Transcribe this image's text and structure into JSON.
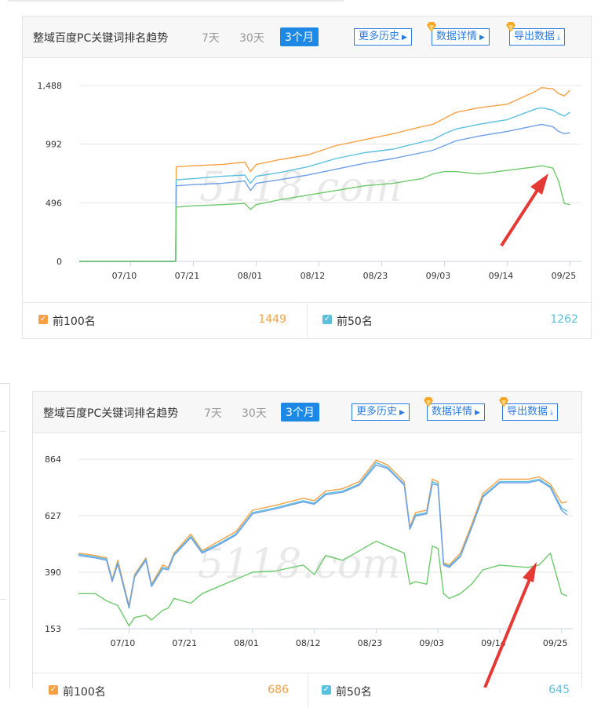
{
  "colors": {
    "top100": "#f5a043",
    "top50": "#5bc0de",
    "top20": "#6f9fe6",
    "top10": "#6cc96c",
    "accent": "#1e88e5",
    "arrow": "#e53935"
  },
  "icons": [
    "vip-diamond-icon",
    "caret-right-icon",
    "download-icon",
    "checkbox-checked-icon",
    "red-arrow-annotation"
  ],
  "panels": [
    {
      "title": "整域百度PC关键词排名趋势",
      "tabs": [
        {
          "label": "7天",
          "active": false
        },
        {
          "label": "30天",
          "active": false
        },
        {
          "label": "3个月",
          "active": true
        }
      ],
      "buttons": {
        "history": "更多历史",
        "details": "数据详情",
        "export": "导出数据"
      },
      "watermark": "5118.com",
      "footer": [
        {
          "label": "前100名",
          "value": "1449"
        },
        {
          "label": "前50名",
          "value": "1262"
        }
      ]
    },
    {
      "title": "整域百度PC关键词排名趋势",
      "tabs": [
        {
          "label": "7天",
          "active": false
        },
        {
          "label": "30天",
          "active": false
        },
        {
          "label": "3个月",
          "active": true
        }
      ],
      "buttons": {
        "history": "更多历史",
        "details": "数据详情",
        "export": "导出数据"
      },
      "watermark": "5118.com",
      "footer": [
        {
          "label": "前100名",
          "value": "686"
        },
        {
          "label": "前50名",
          "value": "645"
        }
      ]
    }
  ],
  "chart_data": [
    {
      "type": "line",
      "ytick_labels": [
        "0",
        "496",
        "992",
        "1,488"
      ],
      "yticks": [
        0,
        496,
        992,
        1488
      ],
      "ylim": [
        0,
        1488
      ],
      "xtick_labels": [
        "07/10",
        "07/21",
        "08/01",
        "08/12",
        "08/23",
        "09/03",
        "09/14",
        "09/25"
      ],
      "xticks": [
        9,
        20,
        31,
        42,
        53,
        64,
        75,
        86
      ],
      "xlim": [
        0,
        88
      ],
      "grid": "horizontal",
      "x": [
        0,
        10,
        16.9,
        17,
        20,
        25,
        29,
        30,
        31,
        35,
        40,
        45,
        50,
        55,
        60,
        62,
        64,
        66,
        70,
        75,
        80,
        81,
        83,
        84,
        85,
        86
      ],
      "series": [
        {
          "values": [
            0,
            0,
            0,
            800,
            810,
            820,
            840,
            760,
            820,
            860,
            900,
            980,
            1030,
            1080,
            1140,
            1160,
            1210,
            1260,
            1300,
            1330,
            1440,
            1470,
            1460,
            1420,
            1400,
            1449
          ]
        },
        {
          "values": [
            0,
            0,
            0,
            690,
            700,
            720,
            730,
            660,
            720,
            750,
            800,
            870,
            920,
            950,
            1010,
            1030,
            1080,
            1120,
            1160,
            1200,
            1290,
            1300,
            1280,
            1250,
            1230,
            1262
          ]
        },
        {
          "values": [
            0,
            0,
            0,
            640,
            650,
            660,
            680,
            600,
            660,
            690,
            730,
            780,
            830,
            870,
            920,
            940,
            980,
            1020,
            1060,
            1100,
            1150,
            1160,
            1140,
            1100,
            1080,
            1090
          ]
        },
        {
          "values": [
            0,
            0,
            0,
            460,
            470,
            480,
            490,
            440,
            480,
            520,
            560,
            600,
            640,
            660,
            700,
            740,
            760,
            760,
            740,
            770,
            800,
            810,
            790,
            680,
            490,
            480
          ]
        }
      ]
    },
    {
      "type": "line",
      "ytick_labels": [
        "153",
        "390",
        "627",
        "864"
      ],
      "yticks": [
        153,
        390,
        627,
        864
      ],
      "ylim": [
        153,
        864
      ],
      "xtick_labels": [
        "07/10",
        "07/21",
        "08/01",
        "08/12",
        "08/23",
        "09/03",
        "09/14",
        "09/25"
      ],
      "xticks": [
        9,
        20,
        31,
        42,
        53,
        64,
        75,
        86
      ],
      "xlim": [
        0,
        88
      ],
      "grid": "horizontal",
      "x": [
        0,
        3,
        5,
        6,
        7,
        9,
        10,
        12,
        13,
        15,
        16,
        17,
        20,
        22,
        25,
        28,
        31,
        35,
        40,
        42,
        44,
        47,
        50,
        53,
        55,
        58,
        59,
        60,
        62,
        63,
        64,
        65,
        66,
        68,
        70,
        72,
        75,
        80,
        82,
        84,
        86,
        87
      ],
      "series": [
        {
          "values": [
            470,
            460,
            450,
            360,
            440,
            250,
            380,
            450,
            340,
            420,
            410,
            470,
            550,
            480,
            520,
            560,
            650,
            670,
            700,
            690,
            730,
            740,
            770,
            860,
            840,
            770,
            580,
            640,
            650,
            780,
            770,
            430,
            420,
            470,
            590,
            720,
            780,
            780,
            790,
            760,
            680,
            686
          ]
        },
        {
          "values": [
            465,
            455,
            445,
            355,
            430,
            245,
            375,
            445,
            335,
            410,
            405,
            465,
            540,
            475,
            510,
            550,
            640,
            660,
            690,
            680,
            720,
            730,
            760,
            850,
            830,
            760,
            575,
            630,
            640,
            770,
            760,
            425,
            415,
            460,
            580,
            710,
            770,
            770,
            780,
            750,
            660,
            645
          ]
        },
        {
          "values": [
            460,
            450,
            440,
            350,
            425,
            240,
            370,
            440,
            330,
            405,
            400,
            460,
            535,
            470,
            505,
            545,
            635,
            655,
            685,
            675,
            715,
            725,
            755,
            840,
            825,
            755,
            570,
            625,
            635,
            760,
            755,
            420,
            410,
            455,
            575,
            705,
            765,
            765,
            775,
            745,
            650,
            630
          ]
        },
        {
          "values": [
            300,
            300,
            270,
            260,
            250,
            165,
            200,
            210,
            190,
            230,
            240,
            280,
            260,
            300,
            330,
            360,
            390,
            395,
            420,
            380,
            460,
            440,
            480,
            520,
            500,
            470,
            340,
            350,
            340,
            500,
            490,
            300,
            280,
            300,
            340,
            400,
            420,
            410,
            420,
            470,
            300,
            290
          ]
        }
      ]
    }
  ]
}
